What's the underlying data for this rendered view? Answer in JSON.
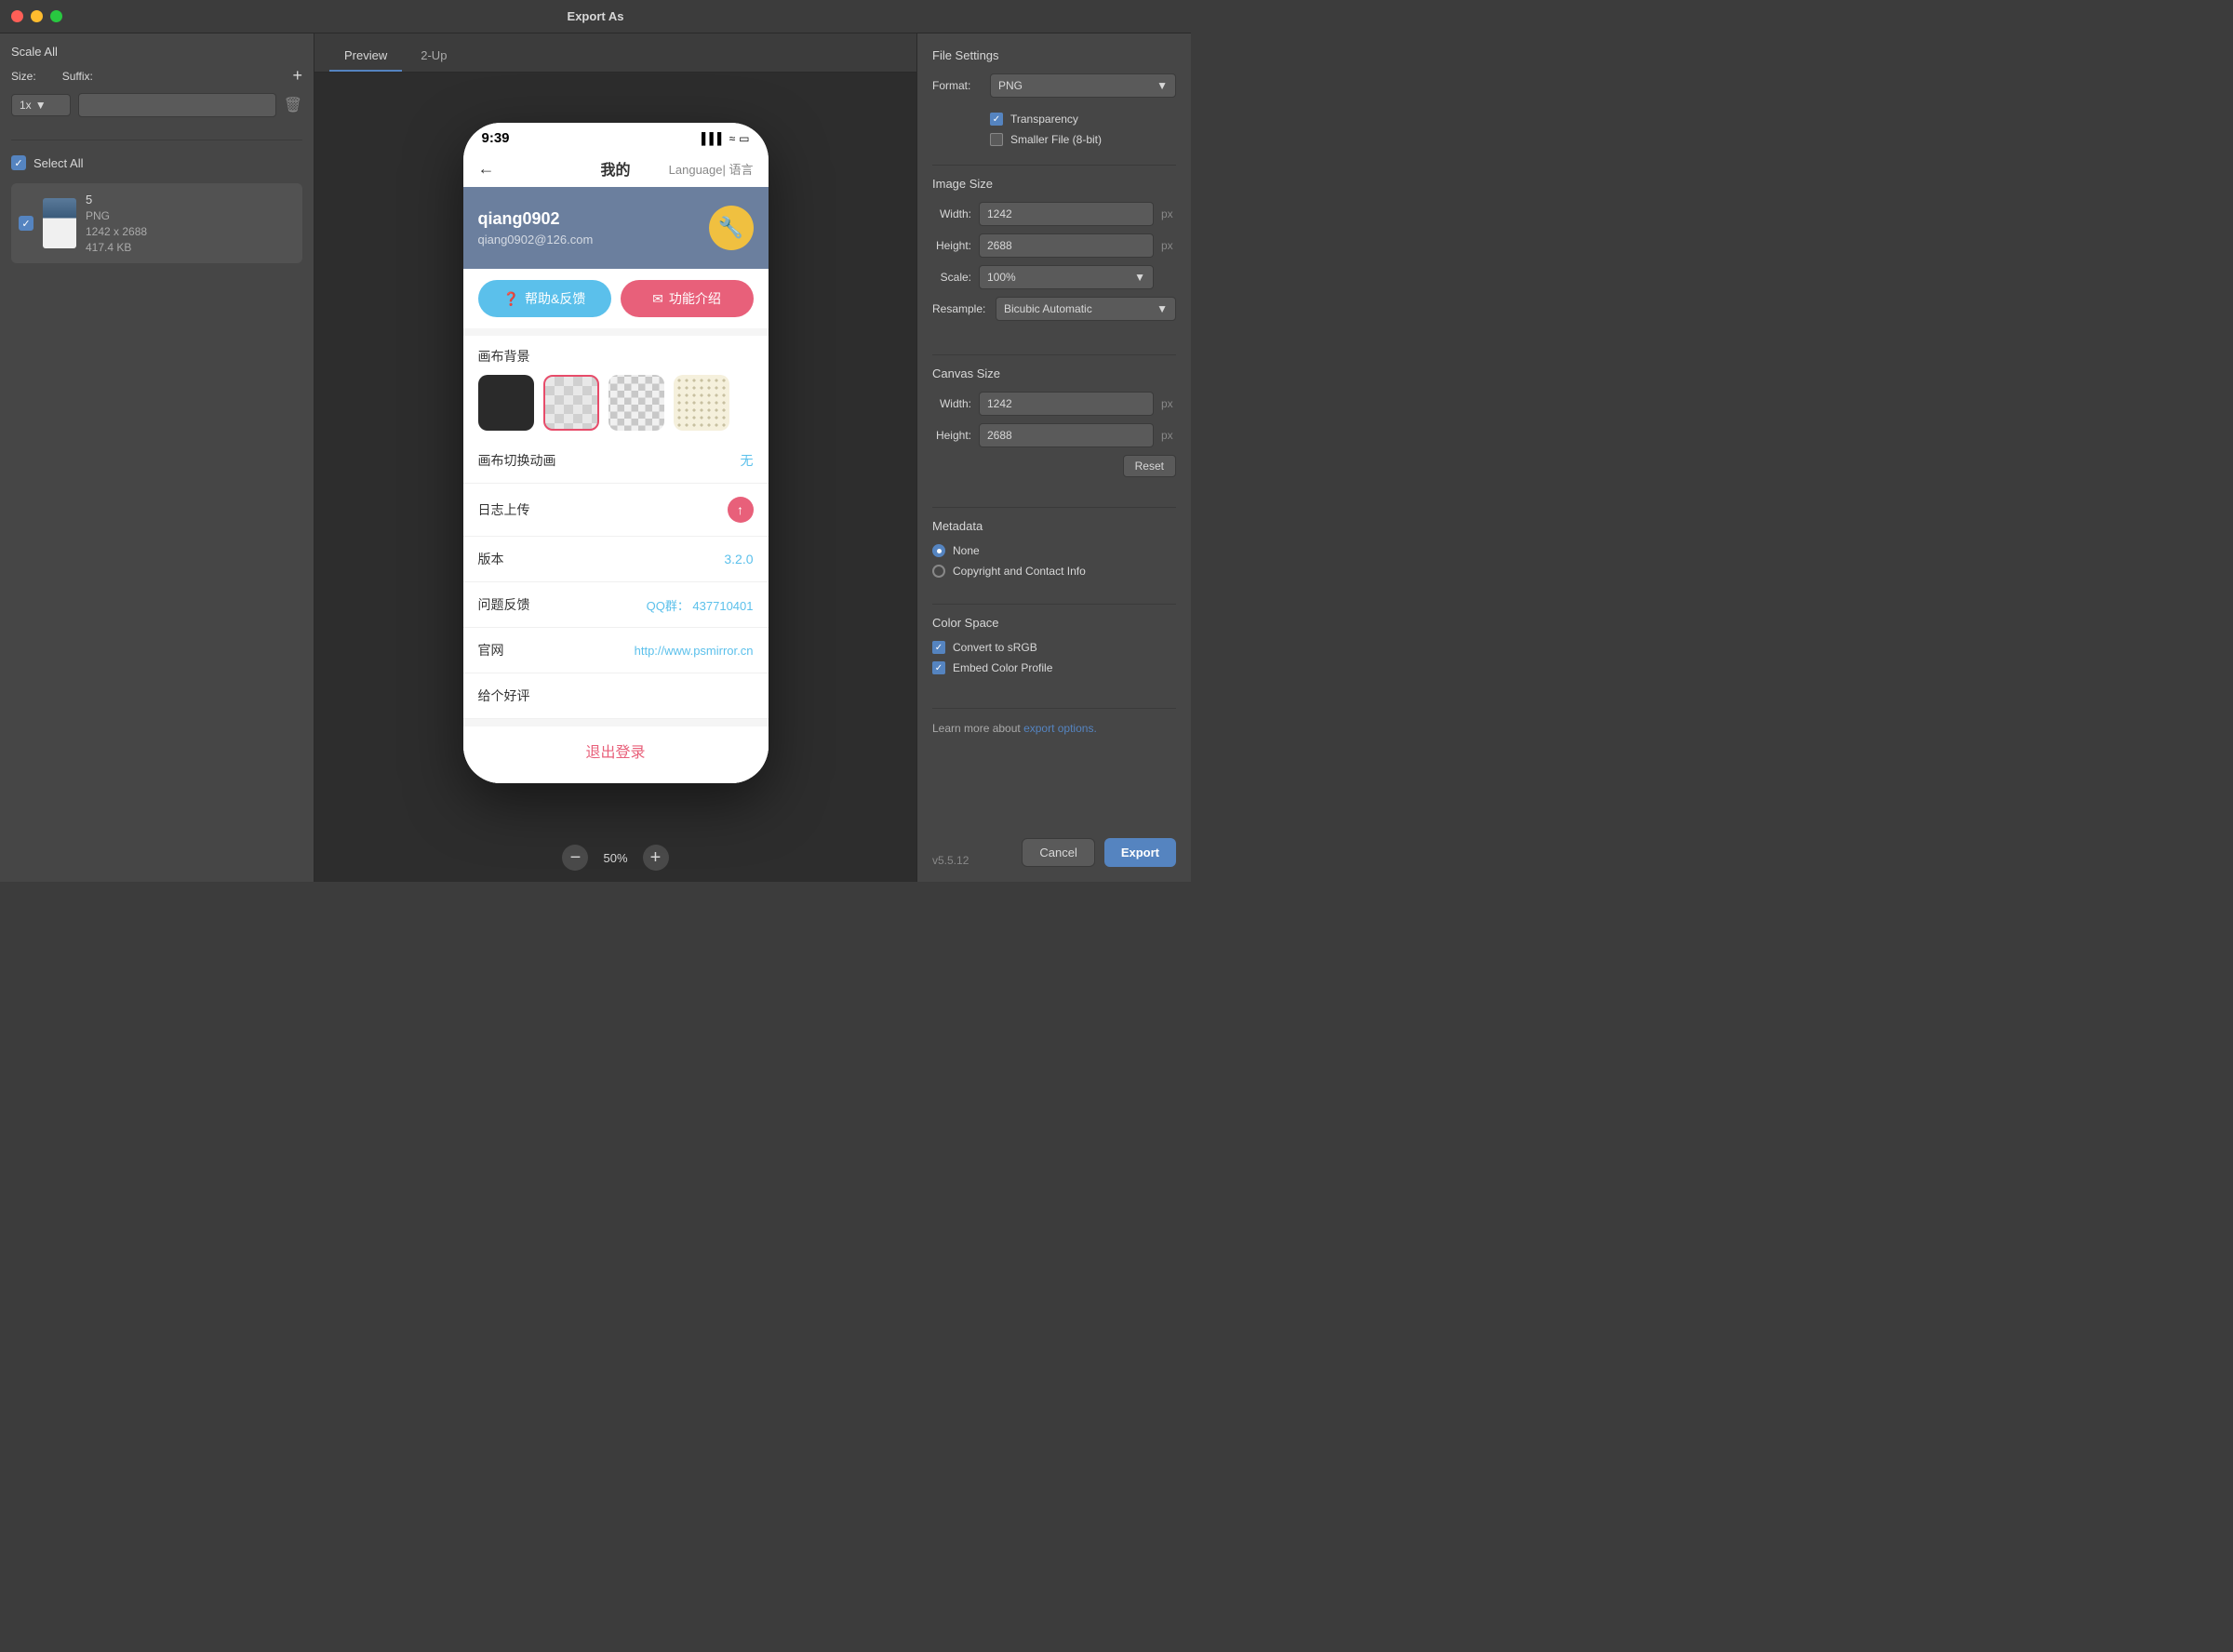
{
  "titlebar": {
    "title": "Export As"
  },
  "left_panel": {
    "scale_all": "Scale All",
    "size_label": "Size:",
    "suffix_label": "Suffix:",
    "add_btn": "+",
    "scale_value": "1x",
    "select_all": "Select All",
    "file": {
      "number": "5",
      "format": "PNG",
      "dimensions": "1242 x 2688",
      "size": "417.4 KB"
    }
  },
  "tabs": {
    "preview": "Preview",
    "two_up": "2-Up"
  },
  "phone": {
    "time": "9:39",
    "nav_title": "我的",
    "nav_lang": "Language| 语言",
    "profile_name": "qiang0902",
    "profile_email": "qiang0902@126.com",
    "profile_icon": "🔧",
    "btn_help": "帮助&反馈",
    "btn_feature": "功能介绍",
    "canvas_title": "画布背景",
    "row_animation": "画布切换动画",
    "row_animation_val": "无",
    "row_log": "日志上传",
    "row_version": "版本",
    "row_version_val": "3.2.0",
    "row_feedback": "问题反馈",
    "row_feedback_val": "QQ群：  437710401",
    "row_website": "官网",
    "row_website_val": "http://www.psmirror.cn",
    "row_rate": "给个好评",
    "logout": "退出登录"
  },
  "zoom": {
    "level": "50%",
    "minus": "−",
    "plus": "+"
  },
  "right_panel": {
    "file_settings": "File Settings",
    "format_label": "Format:",
    "format_value": "PNG",
    "transparency_label": "Transparency",
    "smaller_file_label": "Smaller File (8-bit)",
    "image_size": "Image Size",
    "width_label": "Width:",
    "width_value": "1242",
    "height_label": "Height:",
    "height_value": "2688",
    "scale_label": "Scale:",
    "scale_value": "100%",
    "resample_label": "Resample:",
    "resample_value": "Bicubic Automatic",
    "canvas_size": "Canvas Size",
    "canvas_width_value": "1242",
    "canvas_height_value": "2688",
    "px_label": "px",
    "reset_btn": "Reset",
    "metadata": "Metadata",
    "radio_none": "None",
    "radio_copyright": "Copyright and Contact Info",
    "color_space": "Color Space",
    "convert_srgb": "Convert to sRGB",
    "embed_profile": "Embed Color Profile",
    "learn_more_text": "Learn more about ",
    "learn_more_link": "export options.",
    "version": "v5.5.12",
    "cancel_btn": "Cancel",
    "export_btn": "Export"
  }
}
